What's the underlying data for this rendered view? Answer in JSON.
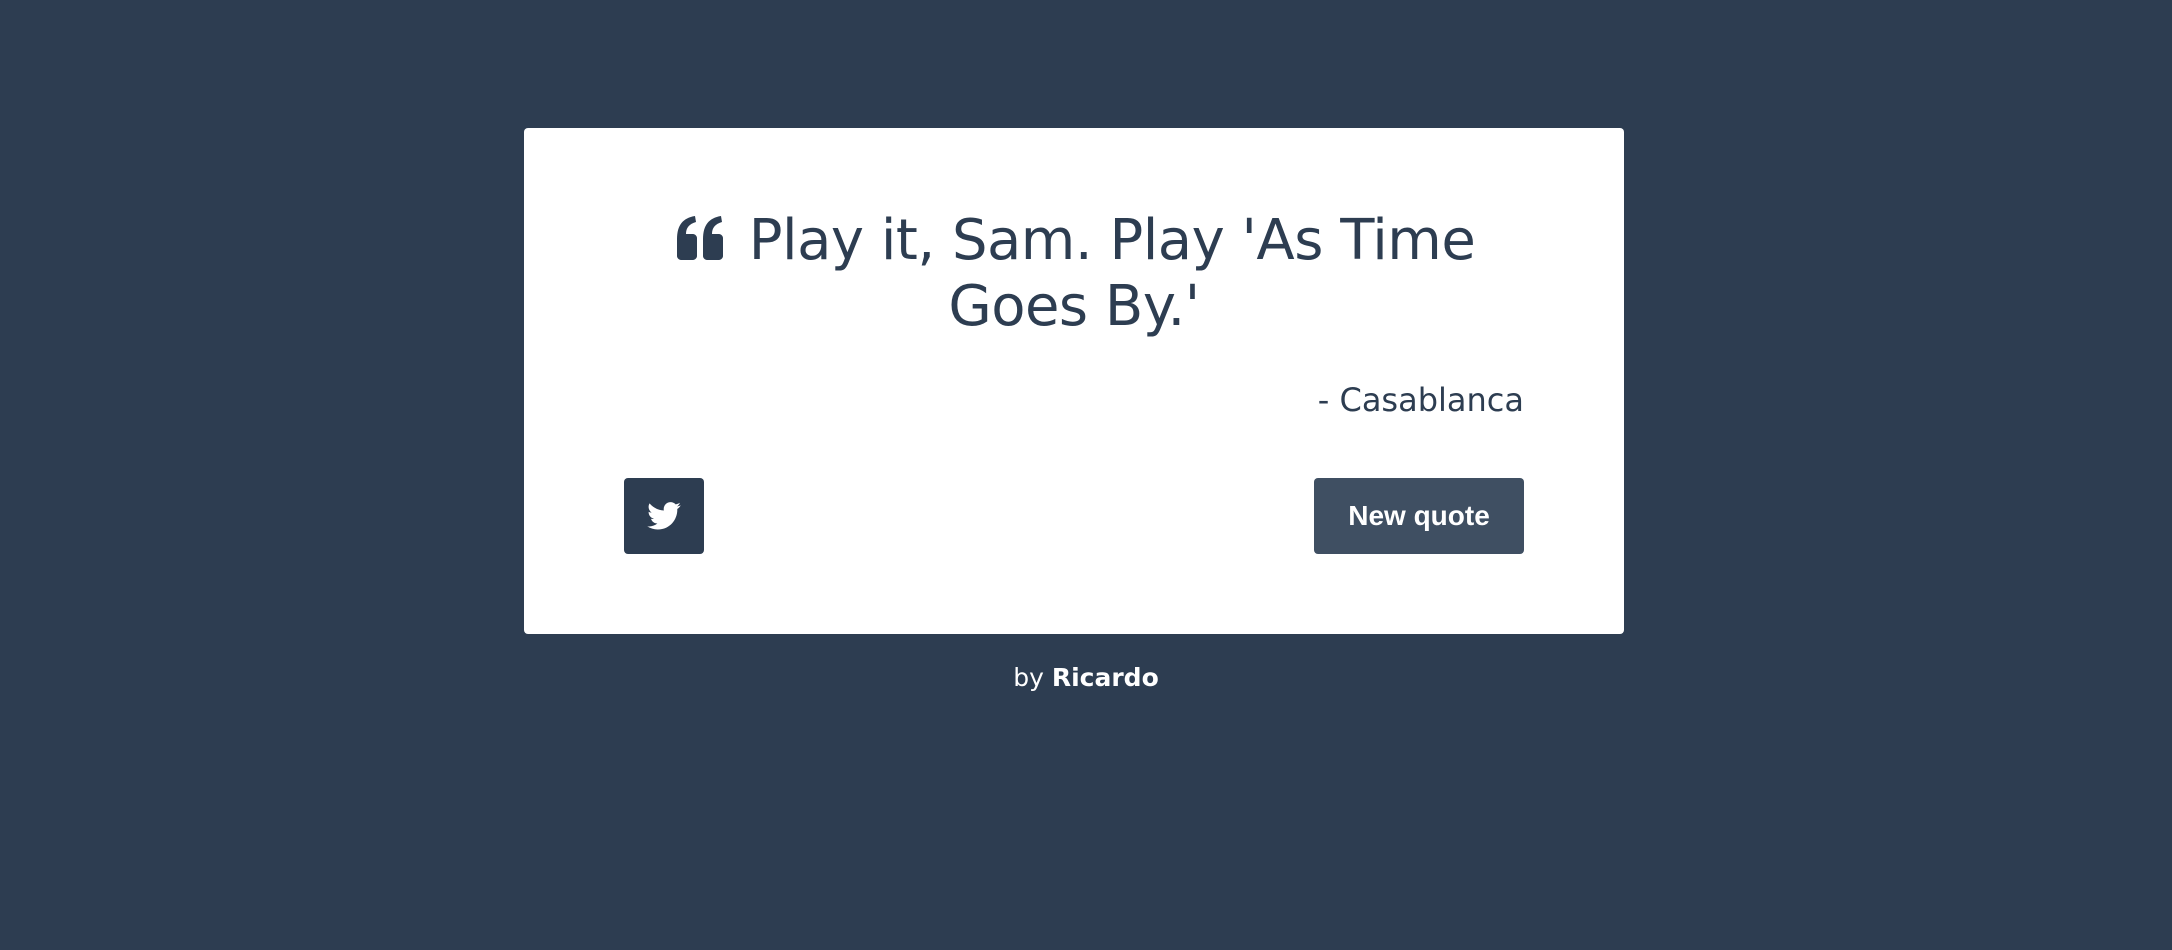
{
  "quote": {
    "text": "Play it, Sam. Play 'As Time Goes By.'",
    "author": "- Casablanca",
    "icon": "quote-left-icon"
  },
  "actions": {
    "tweet_icon": "twitter-icon",
    "new_quote_label": "New quote"
  },
  "footer": {
    "prefix": "by",
    "author": "Ricardo"
  },
  "colors": {
    "background": "#2d3d51",
    "card": "#ffffff",
    "text": "#2d3d51",
    "tweet_button": "#2d3d51",
    "new_quote_button": "#3f4f62"
  }
}
